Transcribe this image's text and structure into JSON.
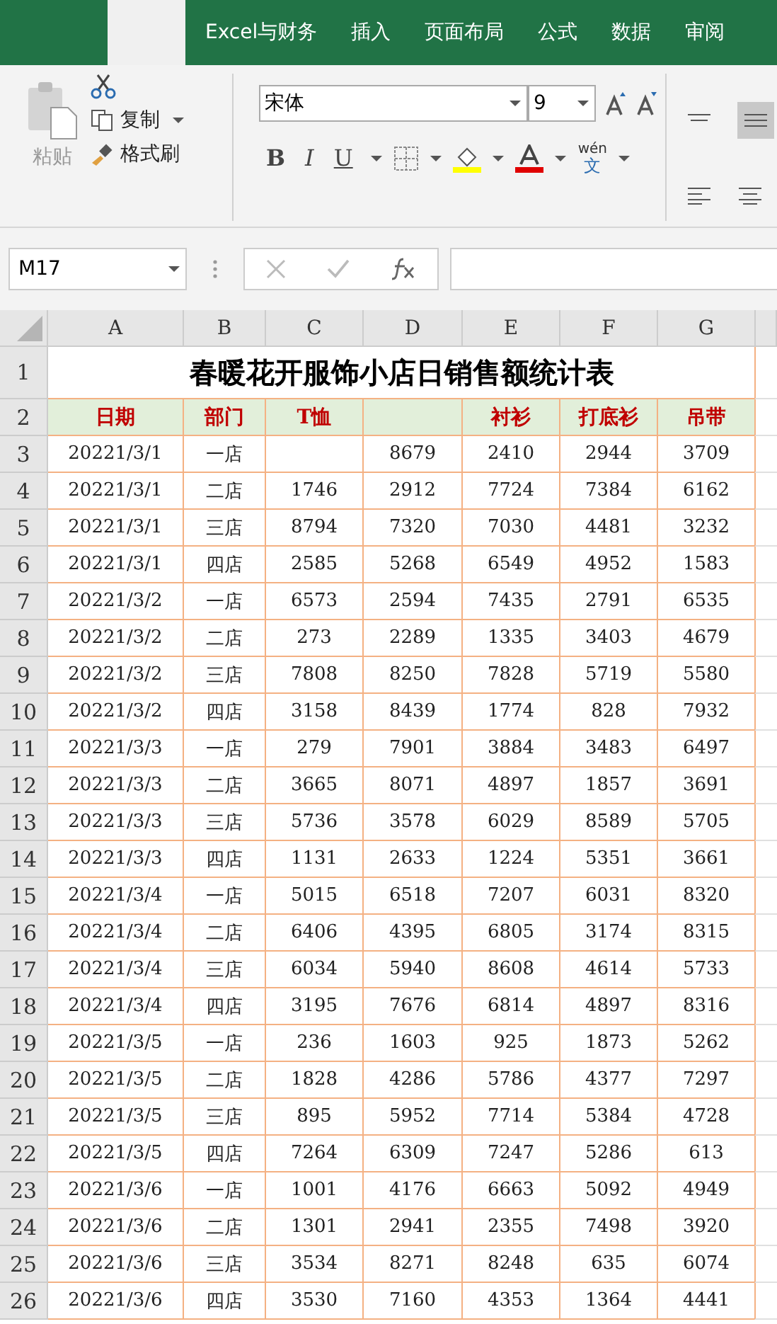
{
  "ribbon_tabs": [
    {
      "label": "Excel与财务",
      "selected": false
    },
    {
      "label": "插入",
      "selected": false
    },
    {
      "label": "页面布局",
      "selected": false
    },
    {
      "label": "公式",
      "selected": false
    },
    {
      "label": "数据",
      "selected": false
    },
    {
      "label": "审阅",
      "selected": false
    }
  ],
  "clipboard": {
    "paste": "粘贴",
    "copy": "复制",
    "format_painter": "格式刷"
  },
  "font": {
    "name": "宋体",
    "size": "9",
    "bold": "B",
    "italic": "I",
    "underline": "U",
    "phonetic_top": "wén",
    "phonetic_bottom": "文"
  },
  "name_box": "M17",
  "column_headers": [
    "A",
    "B",
    "C",
    "D",
    "E",
    "F",
    "G"
  ],
  "title_row": {
    "row_number": "1",
    "title": "春暖花开服饰小店日销售额统计表"
  },
  "header_row": {
    "row_number": "2",
    "headers": [
      {
        "kind": "text",
        "label": "日期"
      },
      {
        "kind": "text",
        "label": "部门"
      },
      {
        "kind": "text",
        "label": "T恤"
      },
      {
        "kind": "blank"
      },
      {
        "kind": "text",
        "label": "衬衫"
      },
      {
        "kind": "text",
        "label": "打底衫"
      },
      {
        "kind": "text",
        "label": "吊带"
      }
    ]
  },
  "rows": [
    {
      "row_number": "3",
      "cells": [
        "20221/3/1",
        "一店",
        {
          "kind": "blank"
        },
        "8679",
        "2410",
        "2944",
        "3709"
      ]
    },
    {
      "row_number": "4",
      "cells": [
        "20221/3/1",
        "二店",
        "1746",
        "2912",
        "7724",
        "7384",
        "6162"
      ]
    },
    {
      "row_number": "5",
      "cells": [
        "20221/3/1",
        "三店",
        "8794",
        "7320",
        "7030",
        "4481",
        "3232"
      ]
    },
    {
      "row_number": "6",
      "cells": [
        "20221/3/1",
        "四店",
        "2585",
        "5268",
        "6549",
        "4952",
        "1583"
      ]
    },
    {
      "row_number": "7",
      "cells": [
        "20221/3/2",
        "一店",
        "6573",
        "2594",
        "7435",
        "2791",
        "6535"
      ]
    },
    {
      "row_number": "8",
      "cells": [
        "20221/3/2",
        "二店",
        "273",
        "2289",
        "1335",
        "3403",
        "4679"
      ]
    },
    {
      "row_number": "9",
      "cells": [
        "20221/3/2",
        "三店",
        "7808",
        "8250",
        "7828",
        "5719",
        "5580"
      ]
    },
    {
      "row_number": "10",
      "cells": [
        "20221/3/2",
        "四店",
        "3158",
        "8439",
        "1774",
        "828",
        "7932"
      ]
    },
    {
      "row_number": "11",
      "cells": [
        "20221/3/3",
        "一店",
        "279",
        "7901",
        "3884",
        "3483",
        "6497"
      ]
    },
    {
      "row_number": "12",
      "cells": [
        "20221/3/3",
        "二店",
        "3665",
        "8071",
        "4897",
        "1857",
        "3691"
      ]
    },
    {
      "row_number": "13",
      "cells": [
        "20221/3/3",
        "三店",
        "5736",
        "3578",
        "6029",
        "8589",
        "5705"
      ]
    },
    {
      "row_number": "14",
      "cells": [
        "20221/3/3",
        "四店",
        "1131",
        "2633",
        "1224",
        "5351",
        "3661"
      ]
    },
    {
      "row_number": "15",
      "cells": [
        "20221/3/4",
        "一店",
        "5015",
        "6518",
        "7207",
        "6031",
        "8320"
      ]
    },
    {
      "row_number": "16",
      "cells": [
        "20221/3/4",
        "二店",
        "6406",
        "4395",
        "6805",
        "3174",
        "8315"
      ]
    },
    {
      "row_number": "17",
      "cells": [
        "20221/3/4",
        "三店",
        "6034",
        "5940",
        "8608",
        "4614",
        "5733"
      ]
    },
    {
      "row_number": "18",
      "cells": [
        "20221/3/4",
        "四店",
        "3195",
        "7676",
        "6814",
        "4897",
        "8316"
      ]
    },
    {
      "row_number": "19",
      "cells": [
        "20221/3/5",
        "一店",
        "236",
        "1603",
        "925",
        "1873",
        "5262"
      ]
    },
    {
      "row_number": "20",
      "cells": [
        "20221/3/5",
        "二店",
        "1828",
        "4286",
        "5786",
        "4377",
        "7297"
      ]
    },
    {
      "row_number": "21",
      "cells": [
        "20221/3/5",
        "三店",
        "895",
        "5952",
        "7714",
        "5384",
        "4728"
      ]
    },
    {
      "row_number": "22",
      "cells": [
        "20221/3/5",
        "四店",
        "7264",
        "6309",
        "7247",
        "5286",
        "613"
      ]
    },
    {
      "row_number": "23",
      "cells": [
        "20221/3/6",
        "一店",
        "1001",
        "4176",
        "6663",
        "5092",
        "4949"
      ]
    },
    {
      "row_number": "24",
      "cells": [
        "20221/3/6",
        "二店",
        "1301",
        "2941",
        "2355",
        "7498",
        "3920"
      ]
    },
    {
      "row_number": "25",
      "cells": [
        "20221/3/6",
        "三店",
        "3534",
        "8271",
        "8248",
        "635",
        "6074"
      ]
    },
    {
      "row_number": "26",
      "cells": [
        "20221/3/6",
        "四店",
        "3530",
        "7160",
        "4353",
        "1364",
        "4441"
      ]
    }
  ]
}
